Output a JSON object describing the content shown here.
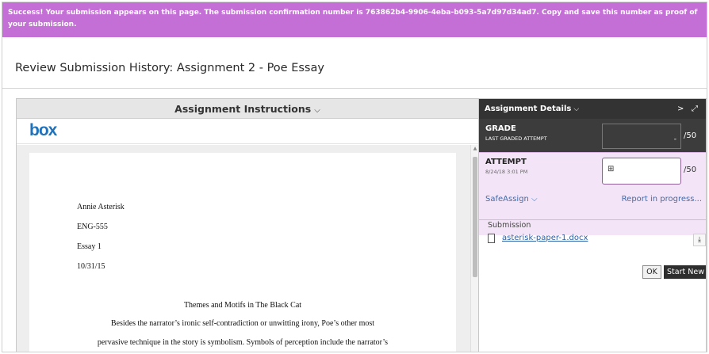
{
  "banner": {
    "text": "Success! Your submission appears on this page. The submission confirmation number is 763862b4-9906-4eba-b093-5a7d97d34ad7. Copy and save this number as proof of your submission."
  },
  "page": {
    "title": "Review Submission History: Assignment 2 - Poe Essay"
  },
  "instructions": {
    "label": "Assignment Instructions",
    "chevron": "⌵",
    "logo": "box"
  },
  "document": {
    "author": "Annie Asterisk",
    "course": "ENG-555",
    "essay": "Essay 1",
    "date": "10/31/15",
    "heading": "Themes and Motifs in The Black Cat",
    "para_line1": "Besides the narrator’s ironic self-contradiction or unwitting irony, Poe’s other most",
    "para_line2": "pervasive technique in the story is symbolism. Symbols of perception include the narrator’s"
  },
  "details": {
    "header": "Assignment Details",
    "chevron": "⌵",
    "next_arrow": ">",
    "expand_icon": "⤢",
    "grade": {
      "label": "GRADE",
      "sublabel": "LAST GRADED ATTEMPT",
      "value": "-",
      "max": "/50"
    },
    "attempt": {
      "label": "ATTEMPT",
      "date": "8/24/18 3:01 PM",
      "max": "/50",
      "safeassign": "SafeAssign ⌵",
      "report": "Report in progress..."
    },
    "submission": {
      "label": "Submission",
      "filename": "asterisk-paper-1.docx",
      "download_icon": "⤓"
    },
    "buttons": {
      "ok": "OK",
      "start_new": "Start New"
    }
  }
}
